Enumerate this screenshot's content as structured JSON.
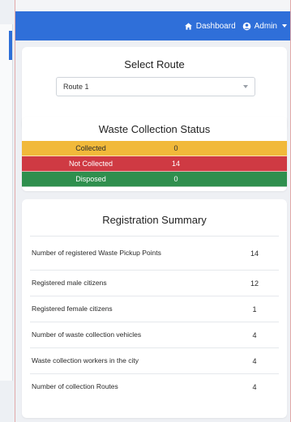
{
  "topbar": {
    "dashboard_label": "Dashboard",
    "admin_label": "Admin",
    "bg_color": "#2f6fd9"
  },
  "route_card": {
    "title": "Select Route",
    "selected_route": "Route 1"
  },
  "status_card": {
    "title": "Waste Collection Status",
    "rows": [
      {
        "label": "Collected",
        "value": "0",
        "color": "#f1b93a"
      },
      {
        "label": "Not Collected",
        "value": "14",
        "color": "#cf3a43"
      },
      {
        "label": "Disposed",
        "value": "0",
        "color": "#2f8f4e"
      }
    ]
  },
  "registration_card": {
    "title": "Registration Summary",
    "rows": [
      {
        "label": "Number of registered Waste Pickup Points",
        "value": "14"
      },
      {
        "label": "Registered male citizens",
        "value": "12"
      },
      {
        "label": "Registered female citizens",
        "value": "1"
      },
      {
        "label": "Number of waste collection vehicles",
        "value": "4"
      },
      {
        "label": "Waste collection workers in the city",
        "value": "4"
      },
      {
        "label": "Number of collection Routes",
        "value": "4"
      }
    ]
  },
  "icons": {
    "dashboard": "dashboard-icon",
    "admin": "user-circle-icon",
    "caret": "chevron-down-icon"
  }
}
